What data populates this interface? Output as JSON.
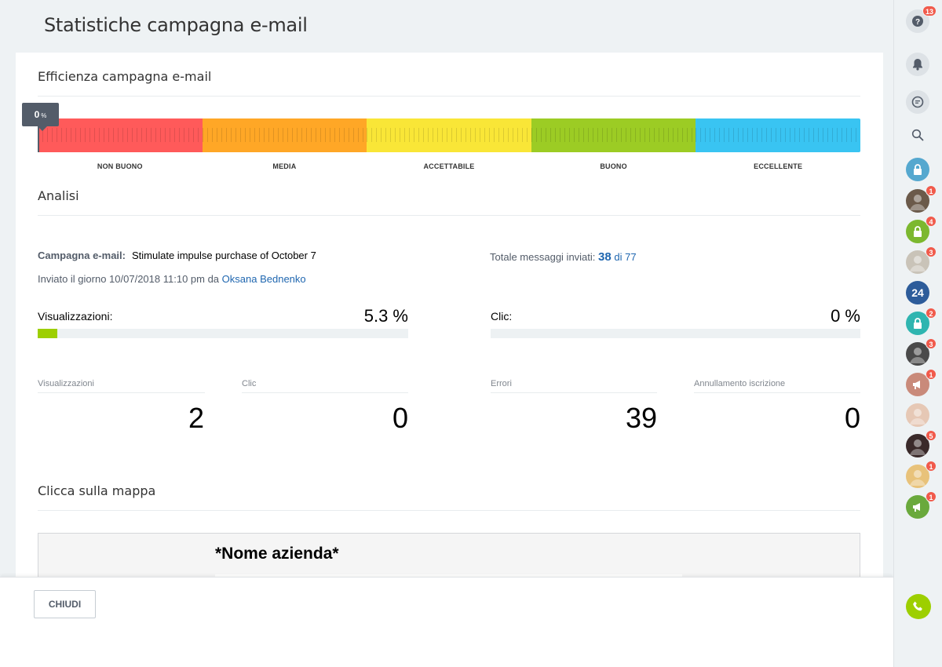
{
  "header": {
    "title": "Statistiche campagna e-mail"
  },
  "efficiency": {
    "title": "Efficienza campagna e-mail",
    "value": "0",
    "unit": "%",
    "segments": [
      {
        "label": "NON BUONO",
        "color": "#ff5a5a"
      },
      {
        "label": "MEDIA",
        "color": "#ffa726"
      },
      {
        "label": "ACCETTABILE",
        "color": "#f9e637"
      },
      {
        "label": "BUONO",
        "color": "#9ccc24"
      },
      {
        "label": "ECCELLENTE",
        "color": "#39c4f2"
      }
    ]
  },
  "analysis": {
    "title": "Analisi",
    "campaign_label": "Campagna e-mail:",
    "campaign_name": "Stimulate impulse purchase of October 7",
    "sent_prefix": "Inviato il giorno 10/07/2018 11:10 pm da",
    "sent_author": "Oksana Bednenko",
    "total_label": "Totale messaggi inviati:",
    "total_sent": "38",
    "total_of": "di",
    "total_count": "77",
    "views_rate_label": "Visualizzazioni:",
    "views_rate_value": "5.3 %",
    "views_rate_fraction": 0.053,
    "clicks_rate_label": "Clic:",
    "clicks_rate_value": "0 %",
    "clicks_rate_fraction": 0,
    "stats": [
      {
        "label": "Visualizzazioni",
        "value": "2"
      },
      {
        "label": "Clic",
        "value": "0"
      },
      {
        "label": "Errori",
        "value": "39"
      },
      {
        "label": "Annullamento iscrizione",
        "value": "0"
      }
    ]
  },
  "map": {
    "title": "Clicca sulla mappa",
    "company": "*Nome azienda*"
  },
  "footer": {
    "close_label": "CHIUDI"
  },
  "sidebar": {
    "help_badge": "13",
    "avatars": [
      {
        "icon": "lock-icon",
        "color": "#55a8cf",
        "badge": ""
      },
      {
        "icon": "photo-avatar",
        "color": "#6b5a4a",
        "badge": "1"
      },
      {
        "icon": "lock-icon",
        "color": "#7cb82f",
        "badge": "4"
      },
      {
        "icon": "photo-avatar",
        "color": "#c9c3b8",
        "badge": "3"
      },
      {
        "icon": "text-avatar",
        "text": "24",
        "color": "#2d5c9a",
        "badge": ""
      },
      {
        "icon": "lock-icon",
        "color": "#2fb5b0",
        "badge": "2"
      },
      {
        "icon": "photo-avatar",
        "color": "#4a4a4a",
        "badge": "3"
      },
      {
        "icon": "megaphone-icon",
        "color": "#c98a7a",
        "badge": "1"
      },
      {
        "icon": "photo-avatar",
        "color": "#e6c8b5",
        "badge": ""
      },
      {
        "icon": "photo-avatar",
        "color": "#3a2a2a",
        "badge": "5"
      },
      {
        "icon": "photo-avatar",
        "color": "#e8c27a",
        "badge": "1"
      },
      {
        "icon": "megaphone-icon",
        "color": "#6aa93c",
        "badge": "1"
      }
    ]
  }
}
